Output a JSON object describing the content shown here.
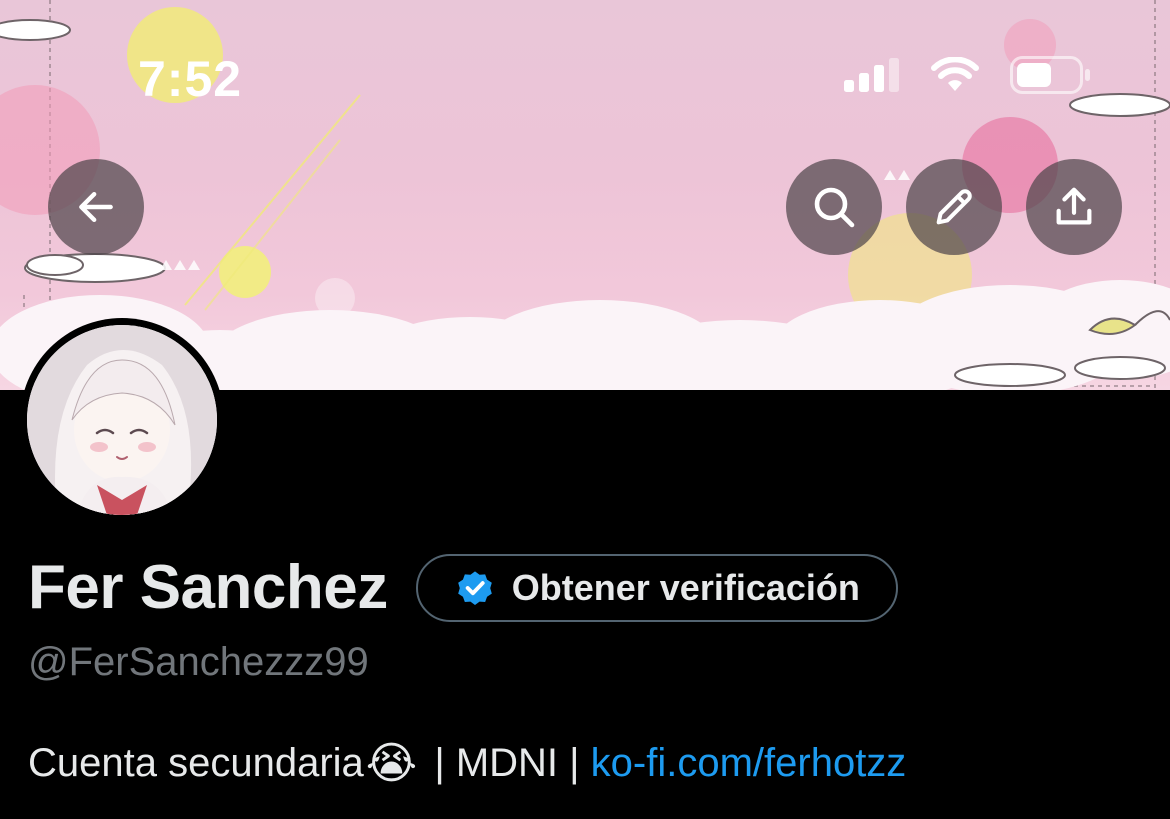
{
  "status_bar": {
    "time": "7:52"
  },
  "header": {
    "back_icon": "arrow-left-icon",
    "search_icon": "search-icon",
    "edit_icon": "pencil-icon",
    "share_icon": "share-upload-icon"
  },
  "profile": {
    "display_name": "Fer Sanchez",
    "verify_button_label": "Obtener verificación",
    "handle": "@FerSanchezzz99",
    "bio_text": "Cuenta secundaria",
    "bio_emoji": "😭",
    "bio_separator_1": " | MDNI | ",
    "bio_link": "ko-fi.com/ferhotzz"
  },
  "colors": {
    "background": "#000000",
    "text_primary": "#e7e9ea",
    "text_secondary": "#71767b",
    "link": "#1d9bf0",
    "verify_badge": "#1d9bf0"
  }
}
